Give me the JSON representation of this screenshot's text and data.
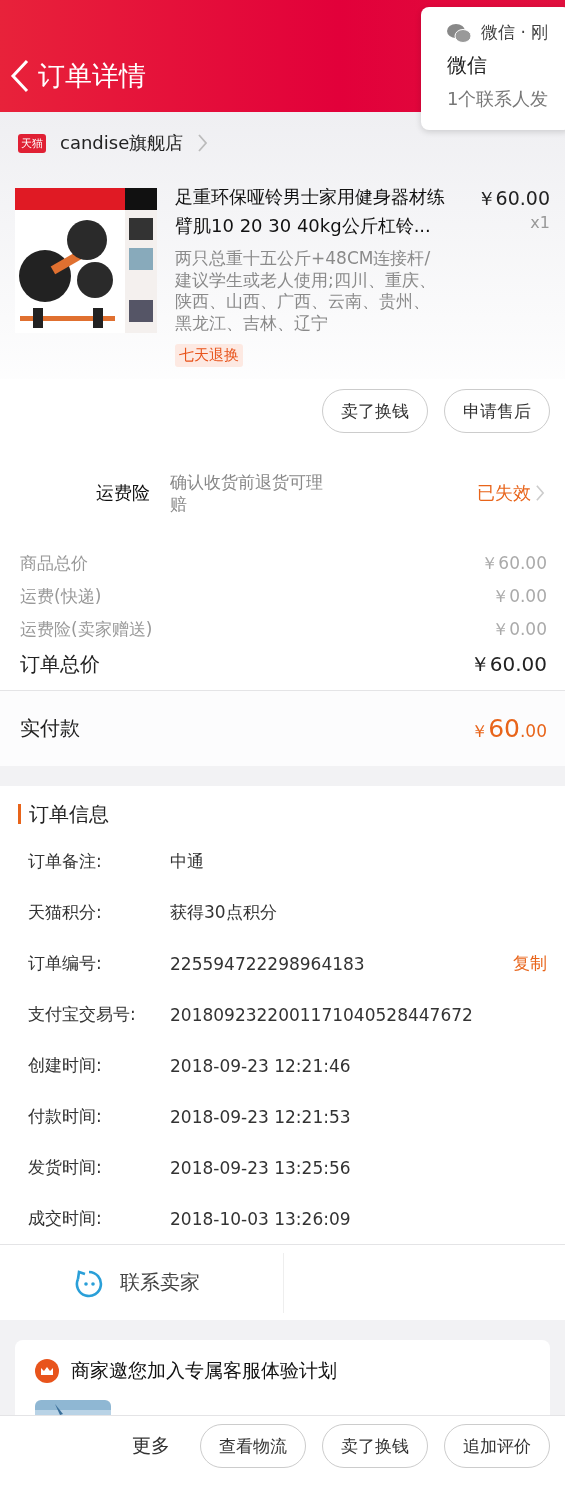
{
  "header": {
    "title": "订单详情"
  },
  "notification": {
    "app": "微信 · 刚",
    "title": "微信",
    "body": "1个联系人发"
  },
  "store": {
    "badge": "天猫",
    "name": "candise旗舰店"
  },
  "product": {
    "title": "足重环保哑铃男士家用健身器材练臂肌10 20 30 40kg公斤杠铃...",
    "spec": "两只总重十五公斤+48CM连接杆/建议学生或老人使用;四川、重庆、陕西、山西、广西、云南、贵州、黑龙江、吉林、辽宁",
    "tag": "七天退换",
    "price": "￥60.00",
    "qty": "x1"
  },
  "item_actions": [
    "卖了换钱",
    "申请售后"
  ],
  "insurance": {
    "label": "运费险",
    "desc": "确认收货前退货可理赔",
    "status": "已失效"
  },
  "charges": [
    {
      "label": "商品总价",
      "value": "￥60.00"
    },
    {
      "label": "运费(快递)",
      "value": "￥0.00"
    },
    {
      "label": "运费险(卖家赠送)",
      "value": "￥0.00"
    }
  ],
  "total": {
    "label": "订单总价",
    "value": "￥60.00"
  },
  "paid": {
    "label": "实付款",
    "currency": "￥",
    "integer": "60",
    "decimal": ".00"
  },
  "order_info": {
    "title": "订单信息",
    "rows": [
      {
        "label": "订单备注:",
        "value": "中通"
      },
      {
        "label": "天猫积分:",
        "value": "获得30点积分"
      },
      {
        "label": "订单编号:",
        "value": "225594722298964183",
        "action": "复制"
      },
      {
        "label": "支付宝交易号:",
        "value": "2018092322001171040528447672"
      },
      {
        "label": "创建时间:",
        "value": "2018-09-23 12:21:46"
      },
      {
        "label": "付款时间:",
        "value": "2018-09-23 12:21:53"
      },
      {
        "label": "发货时间:",
        "value": "2018-09-23 13:25:56"
      },
      {
        "label": "成交时间:",
        "value": "2018-10-03 13:26:09"
      }
    ]
  },
  "contact": {
    "label": "联系卖家"
  },
  "promo": {
    "title": "商家邀您加入专属客服体验计划"
  },
  "bottom_actions": [
    {
      "label": "更多",
      "kind": "text"
    },
    {
      "label": "查看物流",
      "kind": "pill"
    },
    {
      "label": "卖了换钱",
      "kind": "pill"
    },
    {
      "label": "追加评价",
      "kind": "pill"
    }
  ]
}
